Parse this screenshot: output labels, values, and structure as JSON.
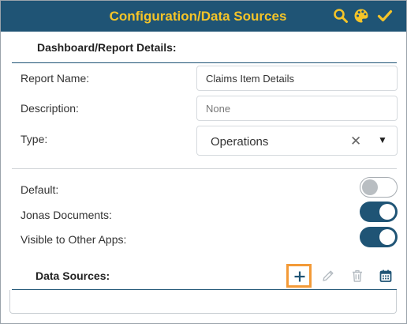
{
  "header": {
    "title": "Configuration/Data Sources",
    "icons": [
      "search-icon",
      "palette-icon",
      "check-icon"
    ]
  },
  "details": {
    "section_title": "Dashboard/Report Details:",
    "report_name_label": "Report Name:",
    "report_name_value": "Claims Item Details",
    "description_label": "Description:",
    "description_placeholder": "None",
    "type_label": "Type:",
    "type_value": "Operations",
    "type_clear": "✕",
    "type_caret": "▼"
  },
  "toggles": [
    {
      "label": "Default:",
      "on": false
    },
    {
      "label": "Jonas Documents:",
      "on": true
    },
    {
      "label": "Visible to Other Apps:",
      "on": true
    }
  ],
  "data_sources": {
    "title": "Data Sources:",
    "actions": [
      "add-icon",
      "edit-icon",
      "delete-icon",
      "calendar-icon"
    ],
    "items": []
  },
  "colors": {
    "header_bg": "#1f5475",
    "header_title": "#f5c428",
    "accent": "#1f5475",
    "highlight": "#f39a37"
  }
}
